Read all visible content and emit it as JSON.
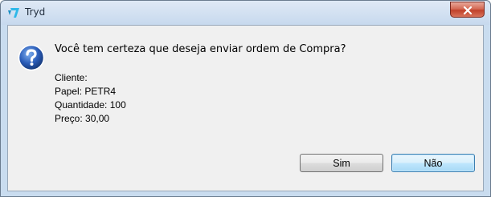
{
  "window": {
    "title": "Tryd",
    "app_icon": "tryd-logo-icon",
    "close_icon": "close-icon"
  },
  "dialog": {
    "icon": "question-icon",
    "question": "Você tem certeza que deseja enviar ordem de Compra?",
    "details": {
      "cliente": "Cliente:",
      "papel": "Papel: PETR4",
      "quantidade": "Quantidade: 100",
      "preco": "Preço: 30,00"
    },
    "buttons": {
      "yes_label": "Sim",
      "no_label": "Não"
    }
  },
  "colors": {
    "accent_blue": "#3c7fb1",
    "close_red": "#c0412a",
    "question_icon_blue": "#2a5cb8"
  }
}
